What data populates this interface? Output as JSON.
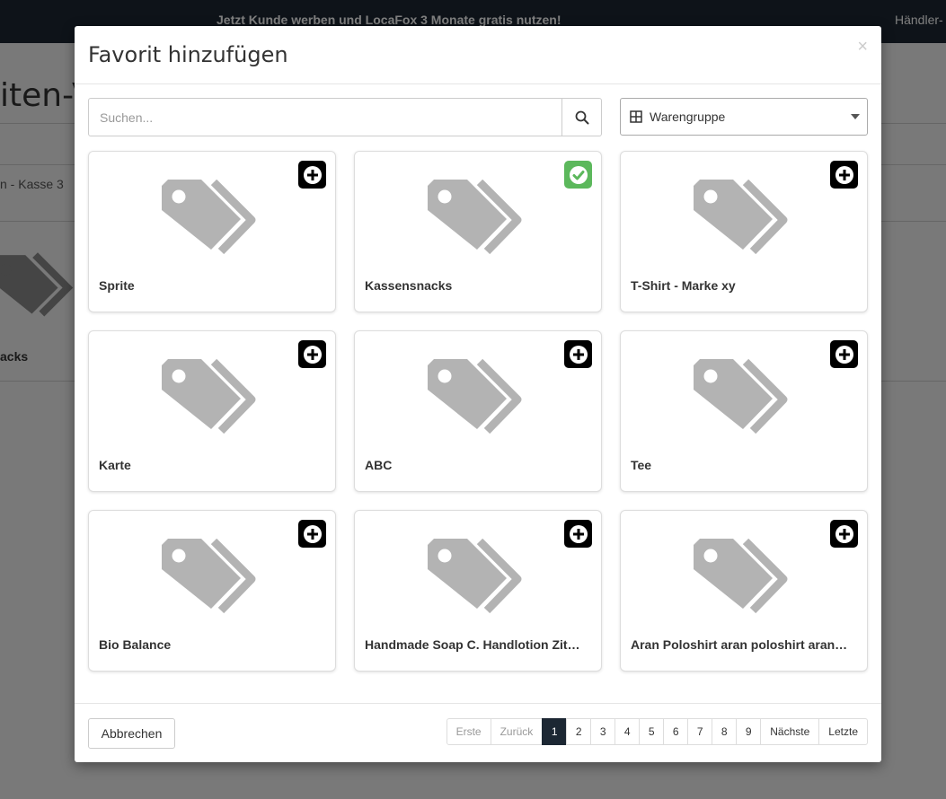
{
  "background": {
    "promo_text": "Jetzt Kunde werben und LocaFox 3 Monate gratis nutzen!",
    "top_right_text": "Händler-",
    "page_title_fragment": "iten-V",
    "kasse_fragment": "n - Kasse 3",
    "product_fragment": "acks"
  },
  "modal": {
    "title": "Favorit hinzufügen",
    "close_symbol": "×",
    "search": {
      "placeholder": "Suchen...",
      "value": ""
    },
    "filter": {
      "label": "Warengruppe",
      "icon": "grid-icon"
    },
    "products": [
      {
        "name": "Sprite",
        "state": "add"
      },
      {
        "name": "Kassensnacks",
        "state": "selected"
      },
      {
        "name": "T-Shirt - Marke xy",
        "state": "add"
      },
      {
        "name": "Karte",
        "state": "add"
      },
      {
        "name": "ABC",
        "state": "add"
      },
      {
        "name": "Tee",
        "state": "add"
      },
      {
        "name": "Bio Balance",
        "state": "add"
      },
      {
        "name": "Handmade Soap C. Handlotion Zit…",
        "state": "add"
      },
      {
        "name": "Aran Poloshirt aran poloshirt aran…",
        "state": "add"
      }
    ],
    "cancel_label": "Abbrechen",
    "pagination": {
      "first": "Erste",
      "prev": "Zurück",
      "pages": [
        "1",
        "2",
        "3",
        "4",
        "5",
        "6",
        "7",
        "8",
        "9"
      ],
      "current": "1",
      "next": "Nächste",
      "last": "Letzte"
    }
  },
  "colors": {
    "topbar": "#1c2733",
    "add_badge": "#000000",
    "selected_badge": "#5cb85c",
    "tag_icon": "#b3b3b3",
    "active_page": "#1c2733"
  }
}
